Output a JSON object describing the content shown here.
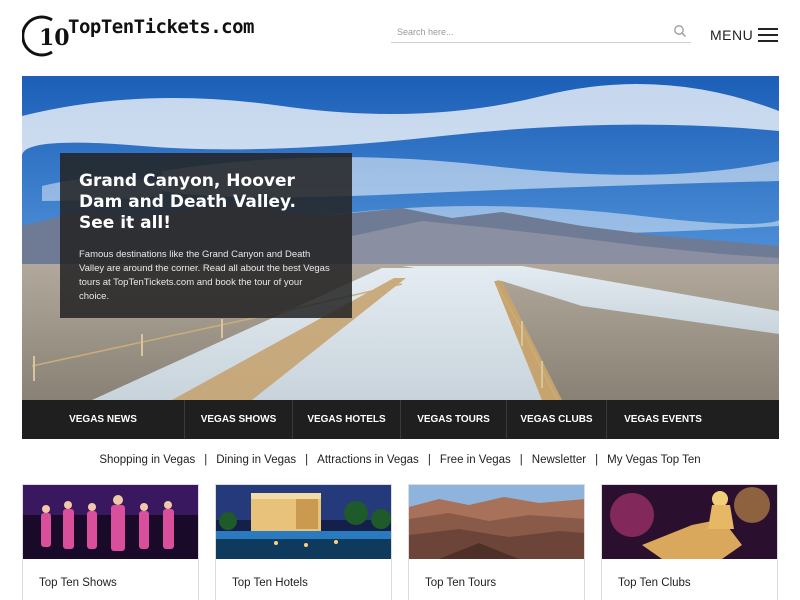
{
  "site": {
    "logo_number": "10",
    "logo_text": "TopTenTickets.com"
  },
  "search": {
    "placeholder": "Search here...",
    "value": ""
  },
  "menu": {
    "label": "MENU"
  },
  "hero": {
    "title": "Grand Canyon, Hoover Dam and Death Valley. See it all!",
    "text": "Famous destinations like the Grand Canyon and Death Valley are around the corner. Read all about the best Vegas tours at TopTenTickets.com and book the tour of your choice."
  },
  "nav": {
    "items": [
      {
        "label": "VEGAS NEWS"
      },
      {
        "label": "VEGAS SHOWS"
      },
      {
        "label": "VEGAS HOTELS"
      },
      {
        "label": "VEGAS TOURS"
      },
      {
        "label": "VEGAS CLUBS"
      },
      {
        "label": "VEGAS EVENTS"
      }
    ]
  },
  "sublinks": [
    "Shopping in Vegas",
    "Dining in Vegas",
    "Attractions in Vegas",
    "Free in Vegas",
    "Newsletter",
    "My Vegas Top Ten"
  ],
  "sublink_separator": "|",
  "cards": [
    {
      "title": "Top Ten Shows"
    },
    {
      "title": "Top Ten Hotels"
    },
    {
      "title": "Top Ten Tours"
    },
    {
      "title": "Top Ten Clubs"
    }
  ],
  "colors": {
    "nav_bg": "#1f1f1f",
    "hero_card_bg": "#232323",
    "sky": "#2d6fc2"
  }
}
